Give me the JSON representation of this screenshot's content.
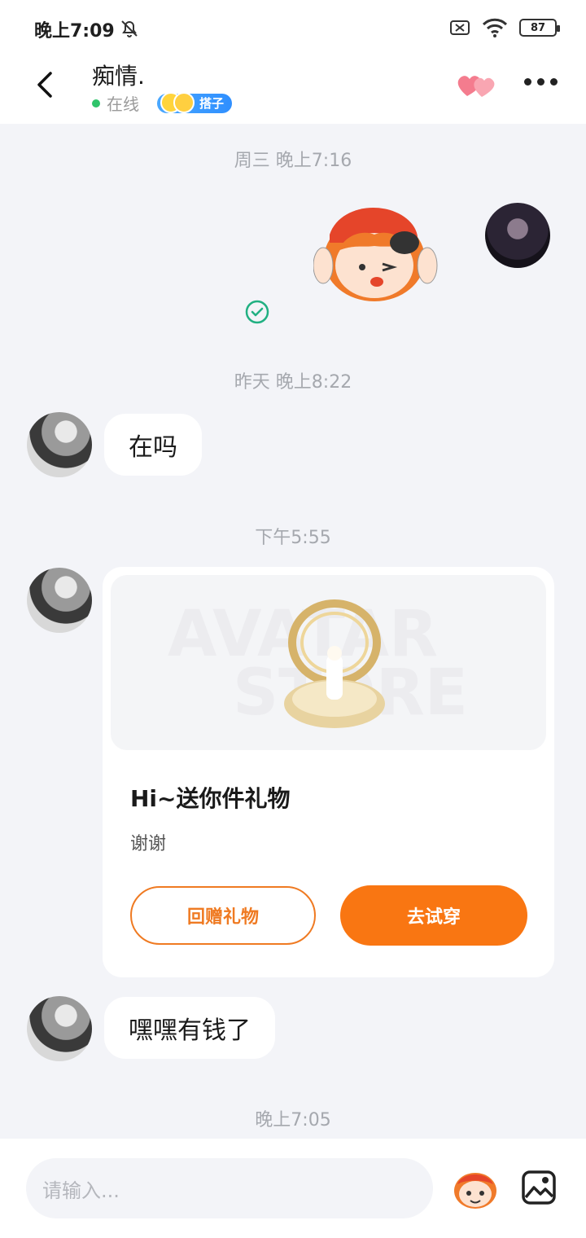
{
  "status_bar": {
    "time": "晚上7:09",
    "battery": "87"
  },
  "header": {
    "name": "痴情.",
    "online": "在线",
    "badge": "搭子"
  },
  "messages": {
    "ts1": "周三 晚上7:16",
    "ts2": "昨天 晚上8:22",
    "msg1": "在吗",
    "ts3": "下午5:55",
    "msg2": "嘿嘿有钱了",
    "ts4": "晚上7:05"
  },
  "gift_card": {
    "title": "Hi~送你件礼物",
    "subtitle": "谢谢",
    "btn_return": "回赠礼物",
    "btn_try": "去试穿",
    "watermark_line1": "AVATAR",
    "watermark_line2": "STORE"
  },
  "input": {
    "placeholder": "请输入..."
  },
  "colors": {
    "accent": "#f97612",
    "online": "#2fc46b",
    "check": "#21b082"
  }
}
